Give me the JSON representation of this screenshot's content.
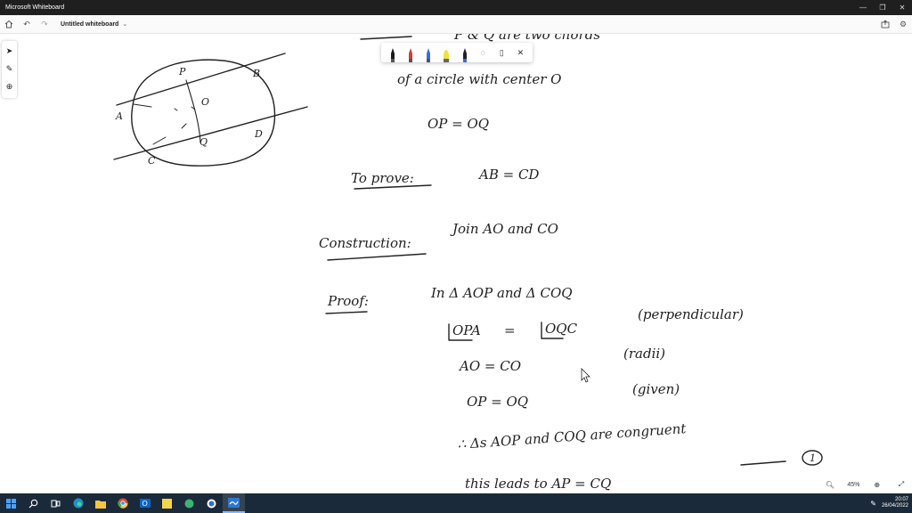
{
  "window": {
    "app_title": "Microsoft Whiteboard",
    "controls": [
      "minimize-icon",
      "restore-icon",
      "close-icon"
    ]
  },
  "toolbar": {
    "doc_title": "Untitled whiteboard",
    "left_icons": [
      "home-icon",
      "undo-icon",
      "redo-icon"
    ],
    "right_icons": [
      "share-icon",
      "settings-icon"
    ]
  },
  "left_rail": {
    "tools": [
      "select-arrow-icon",
      "pen-icon",
      "add-icon"
    ]
  },
  "ink_palette": {
    "pens": [
      {
        "name": "black-pen",
        "color": "#1a1a1a"
      },
      {
        "name": "red-pen",
        "color": "#d23a3a"
      },
      {
        "name": "blue-pen",
        "color": "#3a6fd2"
      },
      {
        "name": "yellow-highlighter",
        "color": "#f2e23a"
      },
      {
        "name": "dark-pen",
        "color": "#222222"
      }
    ],
    "tools": [
      "lasso-icon",
      "ruler-icon",
      "close-icon"
    ]
  },
  "diagram": {
    "points": [
      "P",
      "B",
      "A",
      "O",
      "Q",
      "D",
      "C"
    ]
  },
  "notes": {
    "line_given": "P & Q are two chords",
    "line_circle": "of a circle with center O",
    "line_eq": "OP = OQ",
    "to_prove_label": "To prove:",
    "to_prove_eq": "AB = CD",
    "construction_label": "Construction:",
    "construction_text": "Join AO and CO",
    "proof_label": "Proof:",
    "proof_line1": "In Δ AOP and Δ COQ",
    "proof_line2_left": "OPA",
    "proof_line2_eq": "=",
    "proof_line2_right": "OQC",
    "proof_line2_reason": "(perpendicular)",
    "proof_line3": "AO = CO",
    "proof_line3_reason": "(radii)",
    "proof_line4": "OP = OQ",
    "proof_line4_reason": "(given)",
    "proof_line5": "∴ Δs AOP and COQ are congruent",
    "proof_line6": "this leads to AP = CQ",
    "proof_line6_marker": "1"
  },
  "zoom": {
    "level": "45%"
  },
  "taskbar": {
    "apps": [
      "windows-start-icon",
      "search-icon",
      "task-view-icon",
      "edge-icon",
      "file-explorer-icon",
      "chrome-icon",
      "outlook-icon",
      "sticky-notes-icon",
      "app-green-icon",
      "app-blue-icon",
      "whiteboard-icon"
    ],
    "time": "20:07",
    "date": "26/04/2022"
  }
}
